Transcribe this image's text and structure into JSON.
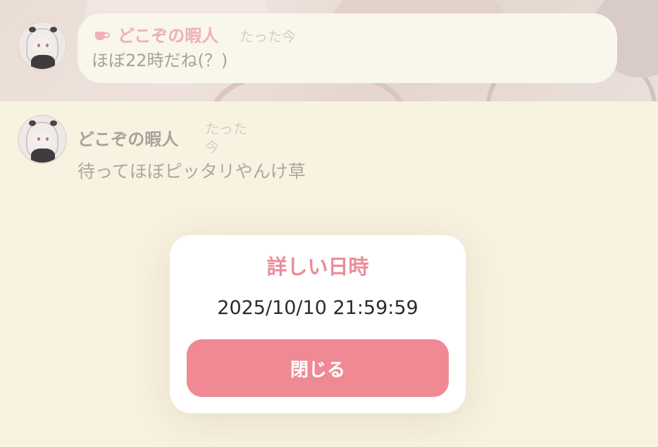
{
  "chat": {
    "messages": [
      {
        "author": "どこぞの暇人",
        "time": "たった今",
        "text": "ほぼ22時だね(？)",
        "icon": "teacup-icon"
      },
      {
        "author": "どこぞの暇人",
        "time": "たった今",
        "text": "待ってほぼピッタリやんけ草"
      }
    ]
  },
  "dialog": {
    "title": "詳しい日時",
    "datetime": "2025/10/10 21:59:59",
    "close_label": "閉じる"
  },
  "colors": {
    "accent": "#ef8a95",
    "title": "#ea8d98",
    "background": "#fdf8e6",
    "bubble": "#fefcf1"
  }
}
